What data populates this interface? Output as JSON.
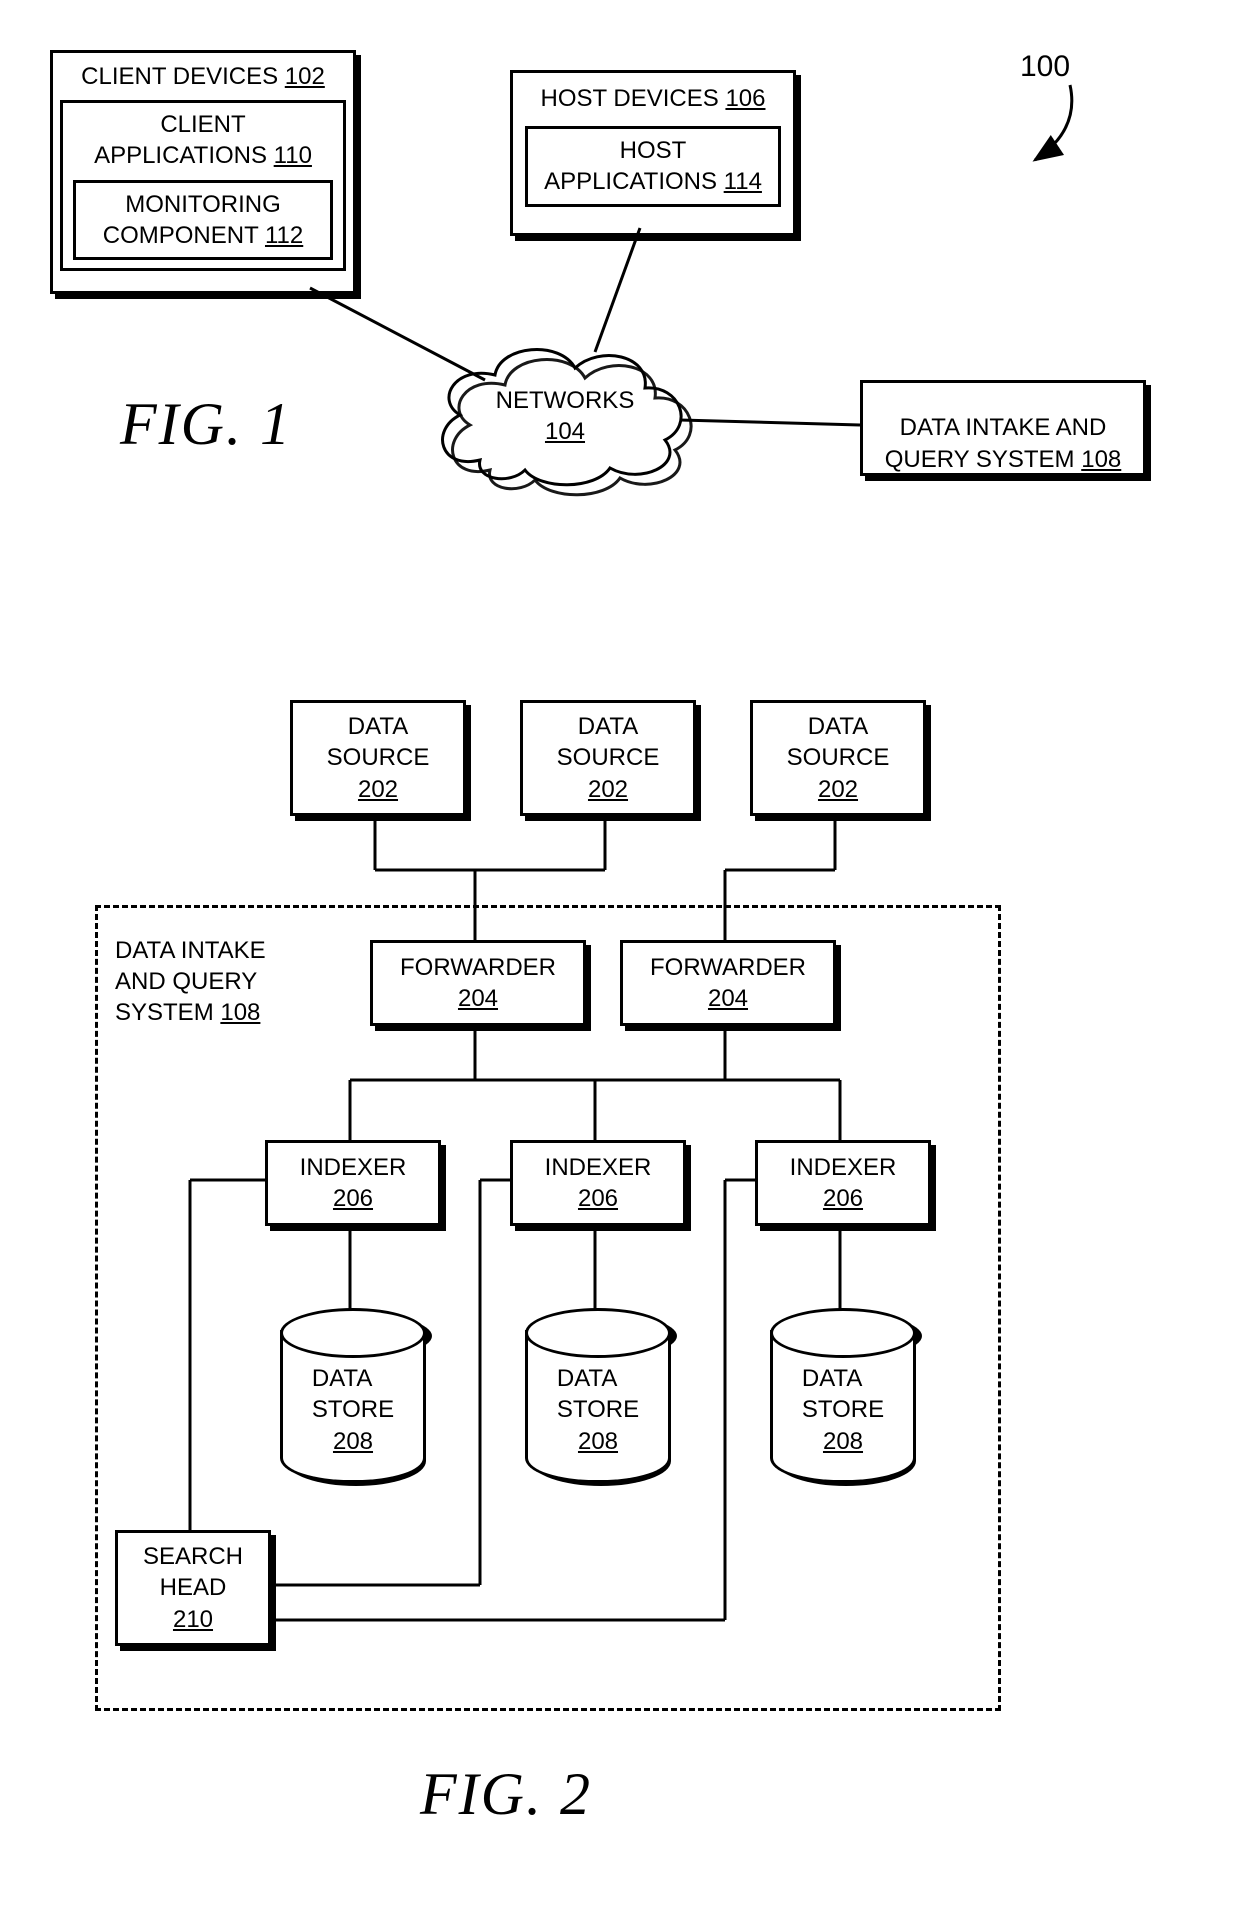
{
  "fig1": {
    "label": "FIG. 1",
    "ref100": "100",
    "client_devices": {
      "title": "CLIENT DEVICES",
      "ref": "102"
    },
    "client_apps": {
      "title": "CLIENT\nAPPLICATIONS",
      "ref": "110"
    },
    "monitoring": {
      "title": "MONITORING\nCOMPONENT",
      "ref": "112"
    },
    "host_devices": {
      "title": "HOST DEVICES",
      "ref": "106"
    },
    "host_apps": {
      "title": "HOST\nAPPLICATIONS",
      "ref": "114"
    },
    "networks": {
      "title": "NETWORKS",
      "ref": "104"
    },
    "diq": {
      "title": "DATA INTAKE AND\nQUERY SYSTEM",
      "ref": "108"
    }
  },
  "fig2": {
    "label": "FIG. 2",
    "container": {
      "title": "DATA INTAKE\nAND QUERY\nSYSTEM",
      "ref": "108"
    },
    "data_source": {
      "title": "DATA\nSOURCE",
      "ref": "202"
    },
    "forwarder": {
      "title": "FORWARDER",
      "ref": "204"
    },
    "indexer": {
      "title": "INDEXER",
      "ref": "206"
    },
    "data_store": {
      "title": "DATA\nSTORE",
      "ref": "208"
    },
    "search_head": {
      "title": "SEARCH\nHEAD",
      "ref": "210"
    }
  }
}
